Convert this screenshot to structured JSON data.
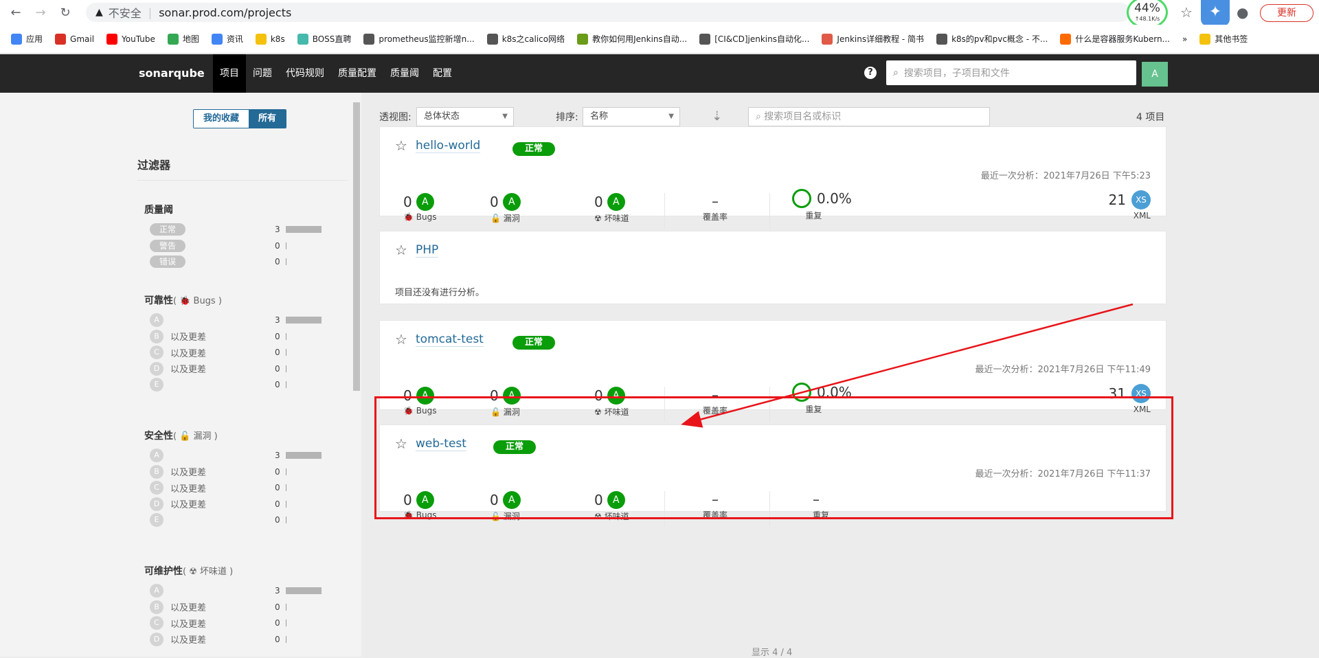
{
  "browser": {
    "insecure_label": "不安全",
    "url": "sonar.prod.com/projects",
    "speed_pct": "44%",
    "speed_rate": "↑48.1K/s",
    "update_label": "更新"
  },
  "bookmarks": [
    {
      "label": "应用",
      "color": "#4285f4"
    },
    {
      "label": "Gmail",
      "color": "#d93025"
    },
    {
      "label": "YouTube",
      "color": "#ff0000"
    },
    {
      "label": "地图",
      "color": "#34a853"
    },
    {
      "label": "资讯",
      "color": "#4285f4"
    },
    {
      "label": "k8s",
      "color": "#f4c20d"
    },
    {
      "label": "BOSS直聘",
      "color": "#46b9ad"
    },
    {
      "label": "prometheus监控新增n...",
      "color": "#555"
    },
    {
      "label": "k8s之calico网络",
      "color": "#555"
    },
    {
      "label": "教你如何用Jenkins自动...",
      "color": "#6a9b19"
    },
    {
      "label": "[CI&CD]jenkins自动化...",
      "color": "#555"
    },
    {
      "label": "Jenkins详细教程 - 简书",
      "color": "#e05a48"
    },
    {
      "label": "k8s的pv和pvc概念 - 不...",
      "color": "#555"
    },
    {
      "label": "什么是容器服务Kubern...",
      "color": "#ff6a00"
    },
    {
      "label": "»",
      "color": "transparent"
    },
    {
      "label": "其他书签",
      "color": "#f4c20d"
    }
  ],
  "nav": {
    "logo_main": "sonar",
    "logo_accent": "qube",
    "items": [
      "项目",
      "问题",
      "代码规则",
      "质量配置",
      "质量阈",
      "配置"
    ],
    "search_placeholder": "搜索项目，子项目和文件",
    "avatar": "A",
    "help": "?"
  },
  "sidebar": {
    "toggle": {
      "favorites": "我的收藏",
      "all": "所有"
    },
    "filters_title": "过滤器",
    "quality_gate": {
      "title": "质量阈",
      "rows": [
        {
          "label": "正常",
          "count": "3",
          "fill": 1.0
        },
        {
          "label": "警告",
          "count": "0",
          "fill": 0
        },
        {
          "label": "错误",
          "count": "0",
          "fill": 0
        }
      ]
    },
    "reliability": {
      "title": "可靠性",
      "sub": "( 🐞 Bugs )",
      "rows": [
        {
          "letter": "A",
          "label": "",
          "count": "3",
          "fill": 1.0
        },
        {
          "letter": "B",
          "label": "以及更差",
          "count": "0",
          "fill": 0
        },
        {
          "letter": "C",
          "label": "以及更差",
          "count": "0",
          "fill": 0
        },
        {
          "letter": "D",
          "label": "以及更差",
          "count": "0",
          "fill": 0
        },
        {
          "letter": "E",
          "label": "",
          "count": "0",
          "fill": 0
        }
      ]
    },
    "security": {
      "title": "安全性",
      "sub": "( 🔓 漏洞 )",
      "rows": [
        {
          "letter": "A",
          "label": "",
          "count": "3",
          "fill": 1.0
        },
        {
          "letter": "B",
          "label": "以及更差",
          "count": "0",
          "fill": 0
        },
        {
          "letter": "C",
          "label": "以及更差",
          "count": "0",
          "fill": 0
        },
        {
          "letter": "D",
          "label": "以及更差",
          "count": "0",
          "fill": 0
        },
        {
          "letter": "E",
          "label": "",
          "count": "0",
          "fill": 0
        }
      ]
    },
    "maintainability": {
      "title": "可维护性",
      "sub": "( ☢ 坏味道 )",
      "rows": [
        {
          "letter": "A",
          "label": "",
          "count": "3",
          "fill": 1.0
        },
        {
          "letter": "B",
          "label": "以及更差",
          "count": "0",
          "fill": 0
        },
        {
          "letter": "C",
          "label": "以及更差",
          "count": "0",
          "fill": 0
        },
        {
          "letter": "D",
          "label": "以及更差",
          "count": "0",
          "fill": 0
        }
      ]
    }
  },
  "toolbar": {
    "perspective_label": "透视图:",
    "perspective_value": "总体状态",
    "sort_label": "排序:",
    "sort_value": "名称",
    "search_placeholder": "搜索项目名或标识",
    "total": "4 项目"
  },
  "projects": [
    {
      "name": "hello-world",
      "status": "正常",
      "last_analysis": "最近一次分析：2021年7月26日 下午5:23",
      "bugs": "0",
      "bugs_label": "Bugs",
      "bugs_rating": "A",
      "vuln": "0",
      "vuln_label": "漏洞",
      "vuln_rating": "A",
      "smells": "0",
      "smells_label": "坏味道",
      "smells_rating": "A",
      "coverage": "–",
      "coverage_label": "覆盖率",
      "dup": "0.0%",
      "dup_label": "重复",
      "size": "21",
      "size_rating": "XS",
      "lang": "XML"
    },
    {
      "name": "PHP",
      "no_analysis": "项目还没有进行分析。"
    },
    {
      "name": "tomcat-test",
      "status": "正常",
      "last_analysis": "最近一次分析：2021年7月26日 下午11:49",
      "bugs": "0",
      "bugs_label": "Bugs",
      "bugs_rating": "A",
      "vuln": "0",
      "vuln_label": "漏洞",
      "vuln_rating": "A",
      "smells": "0",
      "smells_label": "坏味道",
      "smells_rating": "A",
      "coverage": "–",
      "coverage_label": "覆盖率",
      "dup": "0.0%",
      "dup_label": "重复",
      "size": "31",
      "size_rating": "XS",
      "lang": "XML"
    },
    {
      "name": "web-test",
      "status": "正常",
      "last_analysis": "最近一次分析：2021年7月26日 下午11:37",
      "bugs": "0",
      "bugs_label": "Bugs",
      "bugs_rating": "A",
      "vuln": "0",
      "vuln_label": "漏洞",
      "vuln_rating": "A",
      "smells": "0",
      "smells_label": "坏味道",
      "smells_rating": "A",
      "coverage": "–",
      "coverage_label": "覆盖率",
      "dup": "–",
      "dup_label": "重复"
    }
  ],
  "footer": "显示 4 / 4",
  "colors": {
    "accent": "#236a97",
    "ok": "#0a9d0a",
    "annotation": "#e8141a"
  }
}
